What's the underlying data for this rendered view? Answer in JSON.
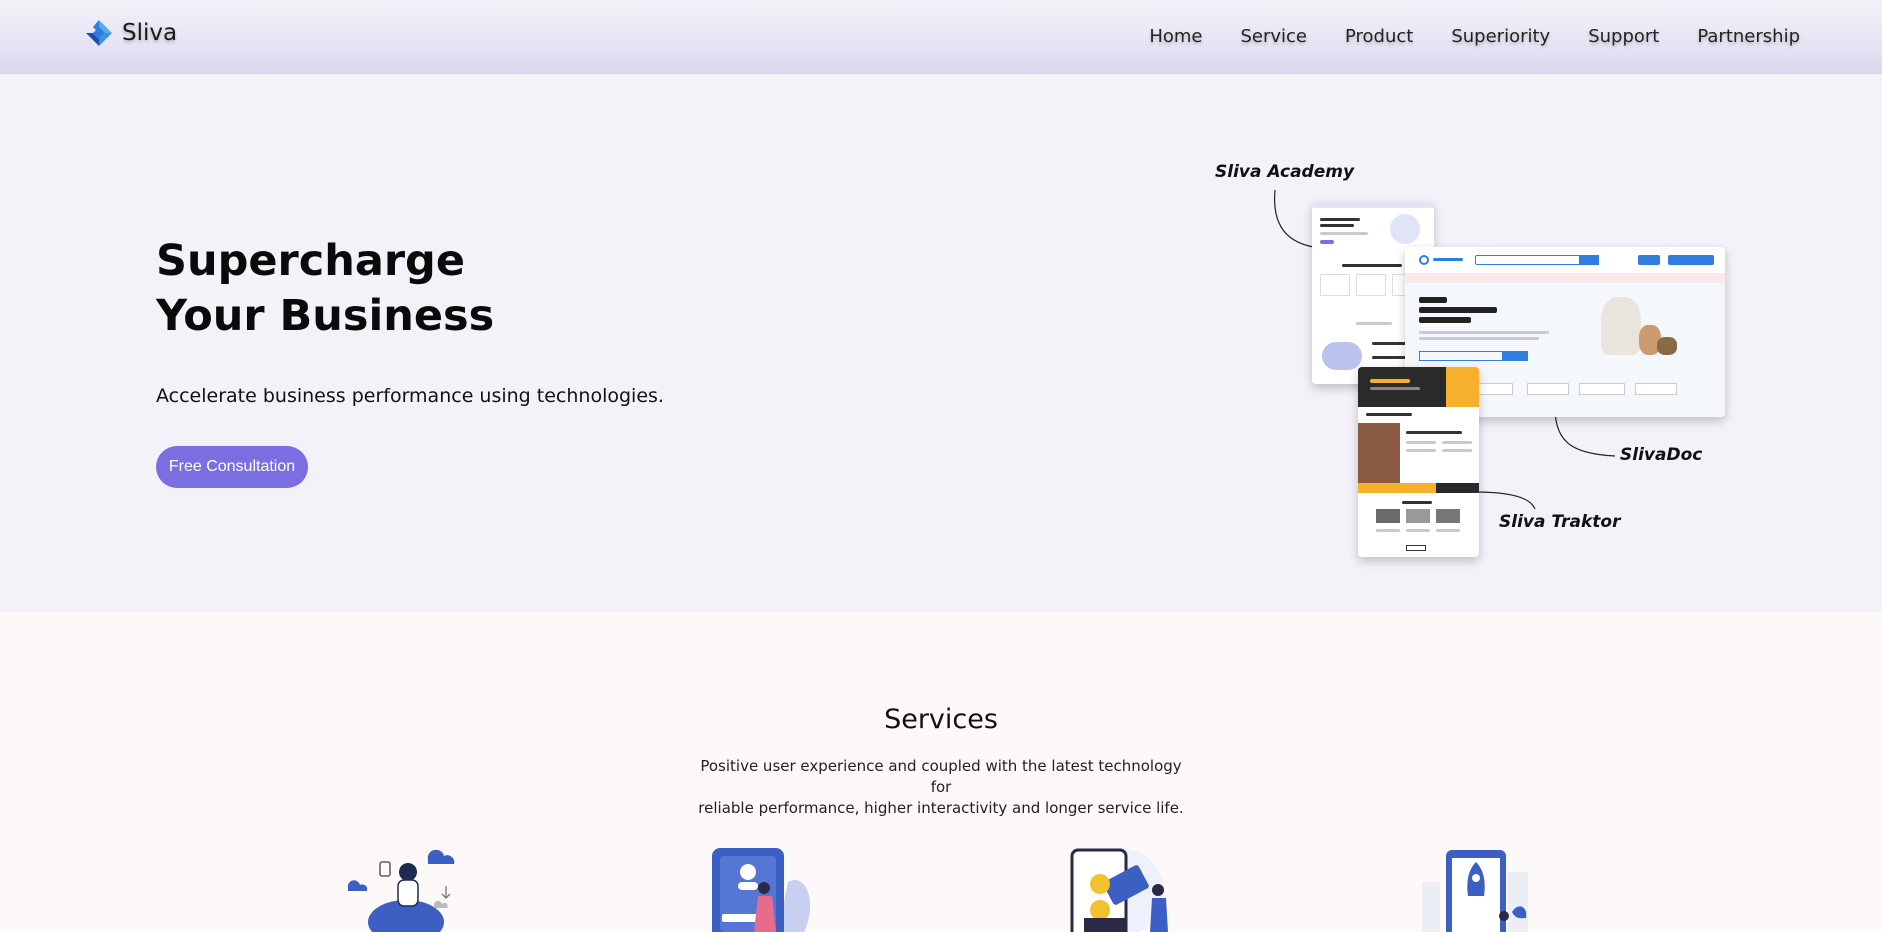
{
  "header": {
    "brand": "Sliva",
    "nav": [
      "Home",
      "Service",
      "Product",
      "Superiority",
      "Support",
      "Partnership"
    ]
  },
  "hero": {
    "title_line1": "Supercharge",
    "title_line2": "Your Business",
    "subtitle": "Accelerate business performance using technologies.",
    "cta_label": "Free Consultation"
  },
  "showcase": {
    "academy_label": "Sliva Academy",
    "doc_label": "SlivaDoc",
    "traktor_label": "Sliva Traktor"
  },
  "services": {
    "title": "Services",
    "desc_line1": "Positive user experience and coupled with the latest technology for",
    "desc_line2": "reliable performance, higher interactivity and longer service life."
  },
  "colors": {
    "accent": "#7b6ee0",
    "logo_blue": "#2f7de1",
    "logo_dark": "#1f4fa8",
    "illus_blue": "#3c5fc4",
    "header_bg": "#e6e4f4",
    "hero_bg": "#f3f2f8"
  }
}
